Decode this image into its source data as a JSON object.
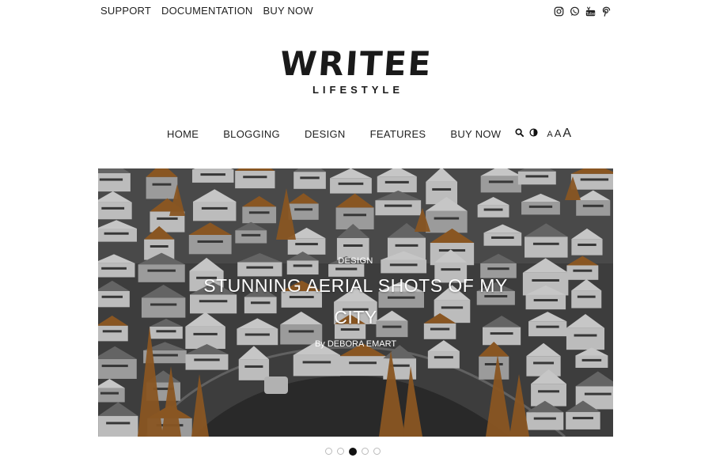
{
  "topbar": {
    "links": [
      "SUPPORT",
      "DOCUMENTATION",
      "BUY NOW"
    ],
    "social_icons": [
      "instagram-icon",
      "whatsapp-icon",
      "youtube-icon",
      "pinterest-icon"
    ]
  },
  "logo": {
    "title": "WRITEE",
    "subtitle": "LIFESTYLE"
  },
  "nav": {
    "items": [
      "HOME",
      "BLOGGING",
      "DESIGN",
      "FEATURES",
      "BUY NOW"
    ],
    "tools": {
      "search_icon": "search-icon",
      "contrast_icon": "contrast-icon",
      "font_small": "A",
      "font_medium": "A",
      "font_large": "A"
    }
  },
  "hero": {
    "category": "DESIGN",
    "title": "STUNNING AERIAL SHOTS OF MY CITY",
    "byline": "By DEBORA EMART"
  },
  "slider": {
    "total": 5,
    "active": 3
  },
  "colors": {
    "text": "#222222",
    "accent_foliage": "#a8692a",
    "hero_overlay": "#000000"
  }
}
